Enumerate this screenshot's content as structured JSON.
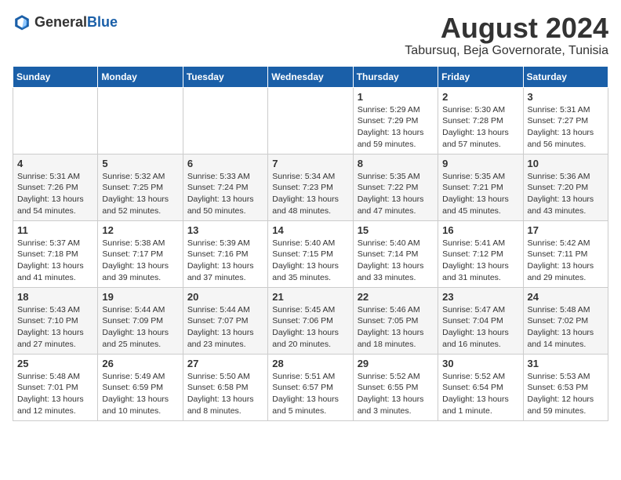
{
  "header": {
    "logo_general": "General",
    "logo_blue": "Blue",
    "month_title": "August 2024",
    "location": "Tabursuq, Beja Governorate, Tunisia"
  },
  "weekdays": [
    "Sunday",
    "Monday",
    "Tuesday",
    "Wednesday",
    "Thursday",
    "Friday",
    "Saturday"
  ],
  "weeks": [
    [
      {
        "day": "",
        "detail": ""
      },
      {
        "day": "",
        "detail": ""
      },
      {
        "day": "",
        "detail": ""
      },
      {
        "day": "",
        "detail": ""
      },
      {
        "day": "1",
        "detail": "Sunrise: 5:29 AM\nSunset: 7:29 PM\nDaylight: 13 hours\nand 59 minutes."
      },
      {
        "day": "2",
        "detail": "Sunrise: 5:30 AM\nSunset: 7:28 PM\nDaylight: 13 hours\nand 57 minutes."
      },
      {
        "day": "3",
        "detail": "Sunrise: 5:31 AM\nSunset: 7:27 PM\nDaylight: 13 hours\nand 56 minutes."
      }
    ],
    [
      {
        "day": "4",
        "detail": "Sunrise: 5:31 AM\nSunset: 7:26 PM\nDaylight: 13 hours\nand 54 minutes."
      },
      {
        "day": "5",
        "detail": "Sunrise: 5:32 AM\nSunset: 7:25 PM\nDaylight: 13 hours\nand 52 minutes."
      },
      {
        "day": "6",
        "detail": "Sunrise: 5:33 AM\nSunset: 7:24 PM\nDaylight: 13 hours\nand 50 minutes."
      },
      {
        "day": "7",
        "detail": "Sunrise: 5:34 AM\nSunset: 7:23 PM\nDaylight: 13 hours\nand 48 minutes."
      },
      {
        "day": "8",
        "detail": "Sunrise: 5:35 AM\nSunset: 7:22 PM\nDaylight: 13 hours\nand 47 minutes."
      },
      {
        "day": "9",
        "detail": "Sunrise: 5:35 AM\nSunset: 7:21 PM\nDaylight: 13 hours\nand 45 minutes."
      },
      {
        "day": "10",
        "detail": "Sunrise: 5:36 AM\nSunset: 7:20 PM\nDaylight: 13 hours\nand 43 minutes."
      }
    ],
    [
      {
        "day": "11",
        "detail": "Sunrise: 5:37 AM\nSunset: 7:18 PM\nDaylight: 13 hours\nand 41 minutes."
      },
      {
        "day": "12",
        "detail": "Sunrise: 5:38 AM\nSunset: 7:17 PM\nDaylight: 13 hours\nand 39 minutes."
      },
      {
        "day": "13",
        "detail": "Sunrise: 5:39 AM\nSunset: 7:16 PM\nDaylight: 13 hours\nand 37 minutes."
      },
      {
        "day": "14",
        "detail": "Sunrise: 5:40 AM\nSunset: 7:15 PM\nDaylight: 13 hours\nand 35 minutes."
      },
      {
        "day": "15",
        "detail": "Sunrise: 5:40 AM\nSunset: 7:14 PM\nDaylight: 13 hours\nand 33 minutes."
      },
      {
        "day": "16",
        "detail": "Sunrise: 5:41 AM\nSunset: 7:12 PM\nDaylight: 13 hours\nand 31 minutes."
      },
      {
        "day": "17",
        "detail": "Sunrise: 5:42 AM\nSunset: 7:11 PM\nDaylight: 13 hours\nand 29 minutes."
      }
    ],
    [
      {
        "day": "18",
        "detail": "Sunrise: 5:43 AM\nSunset: 7:10 PM\nDaylight: 13 hours\nand 27 minutes."
      },
      {
        "day": "19",
        "detail": "Sunrise: 5:44 AM\nSunset: 7:09 PM\nDaylight: 13 hours\nand 25 minutes."
      },
      {
        "day": "20",
        "detail": "Sunrise: 5:44 AM\nSunset: 7:07 PM\nDaylight: 13 hours\nand 23 minutes."
      },
      {
        "day": "21",
        "detail": "Sunrise: 5:45 AM\nSunset: 7:06 PM\nDaylight: 13 hours\nand 20 minutes."
      },
      {
        "day": "22",
        "detail": "Sunrise: 5:46 AM\nSunset: 7:05 PM\nDaylight: 13 hours\nand 18 minutes."
      },
      {
        "day": "23",
        "detail": "Sunrise: 5:47 AM\nSunset: 7:04 PM\nDaylight: 13 hours\nand 16 minutes."
      },
      {
        "day": "24",
        "detail": "Sunrise: 5:48 AM\nSunset: 7:02 PM\nDaylight: 13 hours\nand 14 minutes."
      }
    ],
    [
      {
        "day": "25",
        "detail": "Sunrise: 5:48 AM\nSunset: 7:01 PM\nDaylight: 13 hours\nand 12 minutes."
      },
      {
        "day": "26",
        "detail": "Sunrise: 5:49 AM\nSunset: 6:59 PM\nDaylight: 13 hours\nand 10 minutes."
      },
      {
        "day": "27",
        "detail": "Sunrise: 5:50 AM\nSunset: 6:58 PM\nDaylight: 13 hours\nand 8 minutes."
      },
      {
        "day": "28",
        "detail": "Sunrise: 5:51 AM\nSunset: 6:57 PM\nDaylight: 13 hours\nand 5 minutes."
      },
      {
        "day": "29",
        "detail": "Sunrise: 5:52 AM\nSunset: 6:55 PM\nDaylight: 13 hours\nand 3 minutes."
      },
      {
        "day": "30",
        "detail": "Sunrise: 5:52 AM\nSunset: 6:54 PM\nDaylight: 13 hours\nand 1 minute."
      },
      {
        "day": "31",
        "detail": "Sunrise: 5:53 AM\nSunset: 6:53 PM\nDaylight: 12 hours\nand 59 minutes."
      }
    ]
  ]
}
